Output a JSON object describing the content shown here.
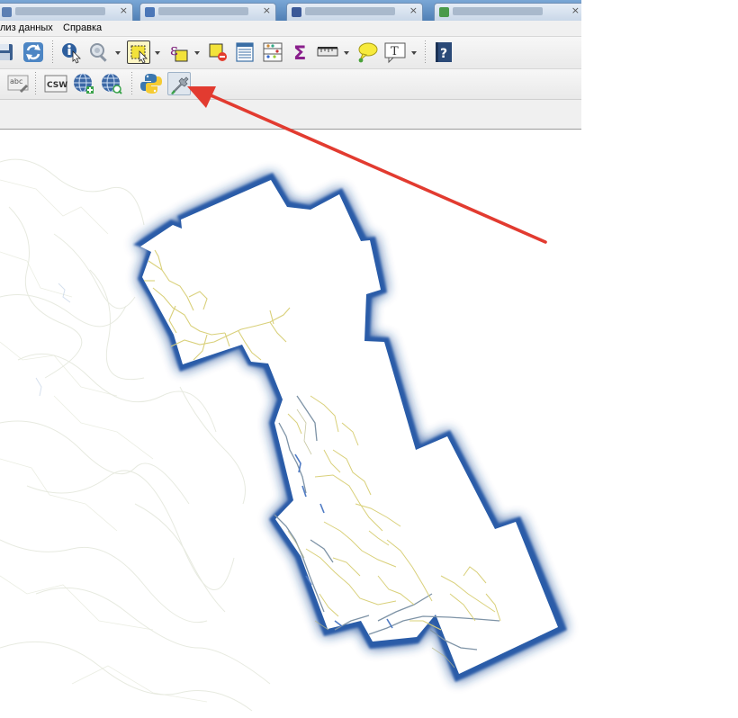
{
  "menubar": {
    "items": [
      {
        "label": "лиз данных"
      },
      {
        "label": "Справка"
      }
    ]
  },
  "toolbar2": {
    "csw_label": "CSW",
    "label_tool_text": "abc"
  },
  "icons": {
    "row1": [
      "save-project-icon",
      "refresh-icon",
      "identify-features-icon",
      "zoom-tool-icon",
      "select-features-icon",
      "expression-select-icon",
      "deselect-features-icon",
      "attribute-table-icon",
      "field-calculator-icon",
      "statistical-summary-icon",
      "measure-line-icon",
      "map-tips-icon",
      "text-annotation-icon",
      "help-icon"
    ],
    "row2": [
      "label-tool-icon",
      "csw-icon",
      "wms-layer-icon",
      "wfs-layer-icon",
      "python-console-icon",
      "plugin-tool-icon"
    ]
  },
  "colors": {
    "arrow": "#e23b30",
    "boundary_glow": "#1f4e99",
    "roads": "#d6cf78",
    "rivers": "#6f89a8",
    "water": "#3d6fd1"
  }
}
